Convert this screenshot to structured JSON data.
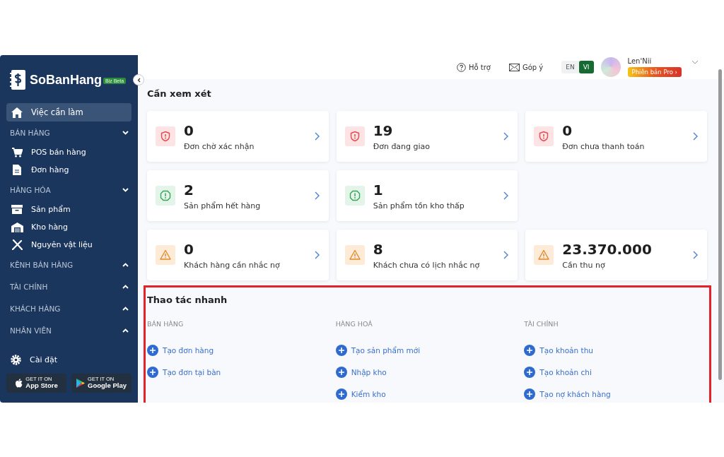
{
  "sidebar": {
    "logo": "SoBanHang",
    "logo_badge": "Biz Beta",
    "items": [
      {
        "kind": "item",
        "label": "Việc cần làm",
        "selected": true
      },
      {
        "kind": "section",
        "label": "BÁN HÀNG",
        "expanded": true
      },
      {
        "kind": "item",
        "label": "POS bán hàng",
        "selected": false
      },
      {
        "kind": "item",
        "label": "Đơn hàng",
        "selected": false
      },
      {
        "kind": "section",
        "label": "HÀNG HÓA",
        "expanded": true
      },
      {
        "kind": "item",
        "label": "Sản phẩm",
        "selected": false
      },
      {
        "kind": "item",
        "label": "Kho hàng",
        "selected": false
      },
      {
        "kind": "item",
        "label": "Nguyên vật liệu",
        "selected": false
      },
      {
        "kind": "section",
        "label": "KÊNH BÁN HÀNG",
        "expanded": false
      },
      {
        "kind": "section",
        "label": "TÀI CHÍNH",
        "expanded": false
      },
      {
        "kind": "section",
        "label": "KHÁCH HÀNG",
        "expanded": false
      },
      {
        "kind": "section",
        "label": "NHÂN VIÊN",
        "expanded": false
      }
    ],
    "settings": "Cài đặt",
    "stores": [
      {
        "kind": "apple",
        "small": "GET IT ON",
        "label": "App Store"
      },
      {
        "kind": "google",
        "small": "GET IT ON",
        "label": "Google Play"
      }
    ]
  },
  "header": {
    "help": "Hỗ trợ",
    "feedback": "Góp ý",
    "languages": [
      {
        "label": "EN",
        "selected": false
      },
      {
        "label": "VI",
        "selected": true
      }
    ],
    "user_name": "Len'Nii",
    "plan_badge": "Phiên bản Pro ›"
  },
  "review": {
    "title": "Cần xem xét",
    "rows": [
      [
        {
          "kind": "danger",
          "value": "0",
          "label": "Đơn chờ xác nhận"
        },
        {
          "kind": "danger",
          "value": "19",
          "label": "Đơn đang giao"
        },
        {
          "kind": "danger",
          "value": "0",
          "label": "Đơn chưa thanh toán"
        }
      ],
      [
        {
          "kind": "info",
          "value": "2",
          "label": "Sản phẩm hết hàng"
        },
        {
          "kind": "info",
          "value": "1",
          "label": "Sản phẩm tồn kho thấp"
        }
      ],
      [
        {
          "kind": "warning",
          "value": "0",
          "label": "Khách hàng cần nhắc nợ"
        },
        {
          "kind": "warning",
          "value": "8",
          "label": "Khách chưa có lịch nhắc nợ"
        },
        {
          "kind": "warning",
          "value": "23.370.000",
          "label": "Cần thu nợ"
        }
      ]
    ]
  },
  "quick_actions": {
    "title": "Thao tác nhanh",
    "highlighted": true,
    "columns": [
      {
        "heading": "BÁN HÀNG",
        "actions": [
          "Tạo đơn hàng",
          "Tạo đơn tại bàn"
        ]
      },
      {
        "heading": "HÀNG HOÁ",
        "actions": [
          "Tạo sản phẩm mới",
          "Nhập kho",
          "Kiểm kho"
        ]
      },
      {
        "heading": "TÀI CHÍNH",
        "actions": [
          "Tạo khoản thu",
          "Tạo khoản chi",
          "Tạo nợ khách hàng"
        ]
      }
    ]
  }
}
